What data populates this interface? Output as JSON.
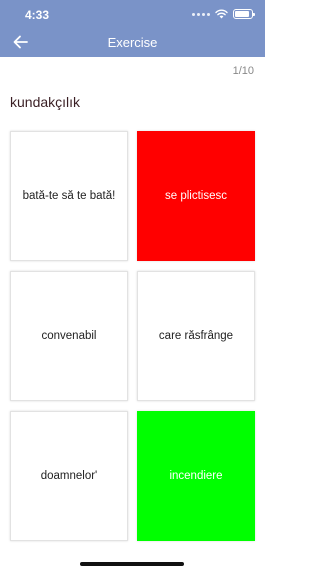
{
  "status": {
    "time": "4:33"
  },
  "nav": {
    "title": "Exercise"
  },
  "progress": "1/10",
  "question": "kundakçılık",
  "answers": [
    {
      "label": "bată-te să te bată!",
      "state": "neutral"
    },
    {
      "label": "se plictisesc",
      "state": "wrong"
    },
    {
      "label": "convenabil",
      "state": "neutral"
    },
    {
      "label": "care răsfrânge",
      "state": "neutral"
    },
    {
      "label": "doamnelor'",
      "state": "neutral"
    },
    {
      "label": "incendiere",
      "state": "correct"
    }
  ],
  "colors": {
    "header": "#7a93c8",
    "wrong": "#ff0000",
    "correct": "#00ff00"
  },
  "icons": {
    "back": "arrow-left-icon",
    "signal": "signal-dots-icon",
    "wifi": "wifi-icon",
    "battery": "battery-icon"
  }
}
